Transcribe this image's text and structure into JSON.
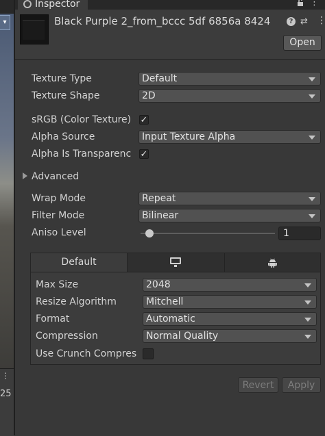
{
  "left_strip": {
    "lower_value": "25"
  },
  "tab": {
    "title": "Inspector"
  },
  "header": {
    "asset_title": "Black Purple 2_from_bccc 5df 6856a 8424",
    "open_label": "Open"
  },
  "fields": {
    "texture_type": {
      "label": "Texture Type",
      "value": "Default"
    },
    "texture_shape": {
      "label": "Texture Shape",
      "value": "2D"
    },
    "srgb": {
      "label": "sRGB (Color Texture)",
      "checked": true
    },
    "alpha_source": {
      "label": "Alpha Source",
      "value": "Input Texture Alpha"
    },
    "alpha_is_transparency": {
      "label": "Alpha Is Transparenc",
      "checked": true
    },
    "advanced": {
      "label": "Advanced"
    },
    "wrap_mode": {
      "label": "Wrap Mode",
      "value": "Repeat"
    },
    "filter_mode": {
      "label": "Filter Mode",
      "value": "Bilinear"
    },
    "aniso_level": {
      "label": "Aniso Level",
      "value": "1"
    }
  },
  "platform": {
    "tabs": [
      {
        "label": "Default"
      },
      {
        "icon": "monitor-icon"
      },
      {
        "icon": "android-icon"
      }
    ],
    "max_size": {
      "label": "Max Size",
      "value": "2048"
    },
    "resize_algorithm": {
      "label": "Resize Algorithm",
      "value": "Mitchell"
    },
    "format": {
      "label": "Format",
      "value": "Automatic"
    },
    "compression": {
      "label": "Compression",
      "value": "Normal Quality"
    },
    "use_crunch": {
      "label": "Use Crunch Compres",
      "checked": false
    }
  },
  "footer": {
    "revert_label": "Revert",
    "apply_label": "Apply"
  },
  "colors": {
    "accent": "#5d8ad6",
    "panel": "#3c3c3c",
    "dropdown": "#515151"
  }
}
